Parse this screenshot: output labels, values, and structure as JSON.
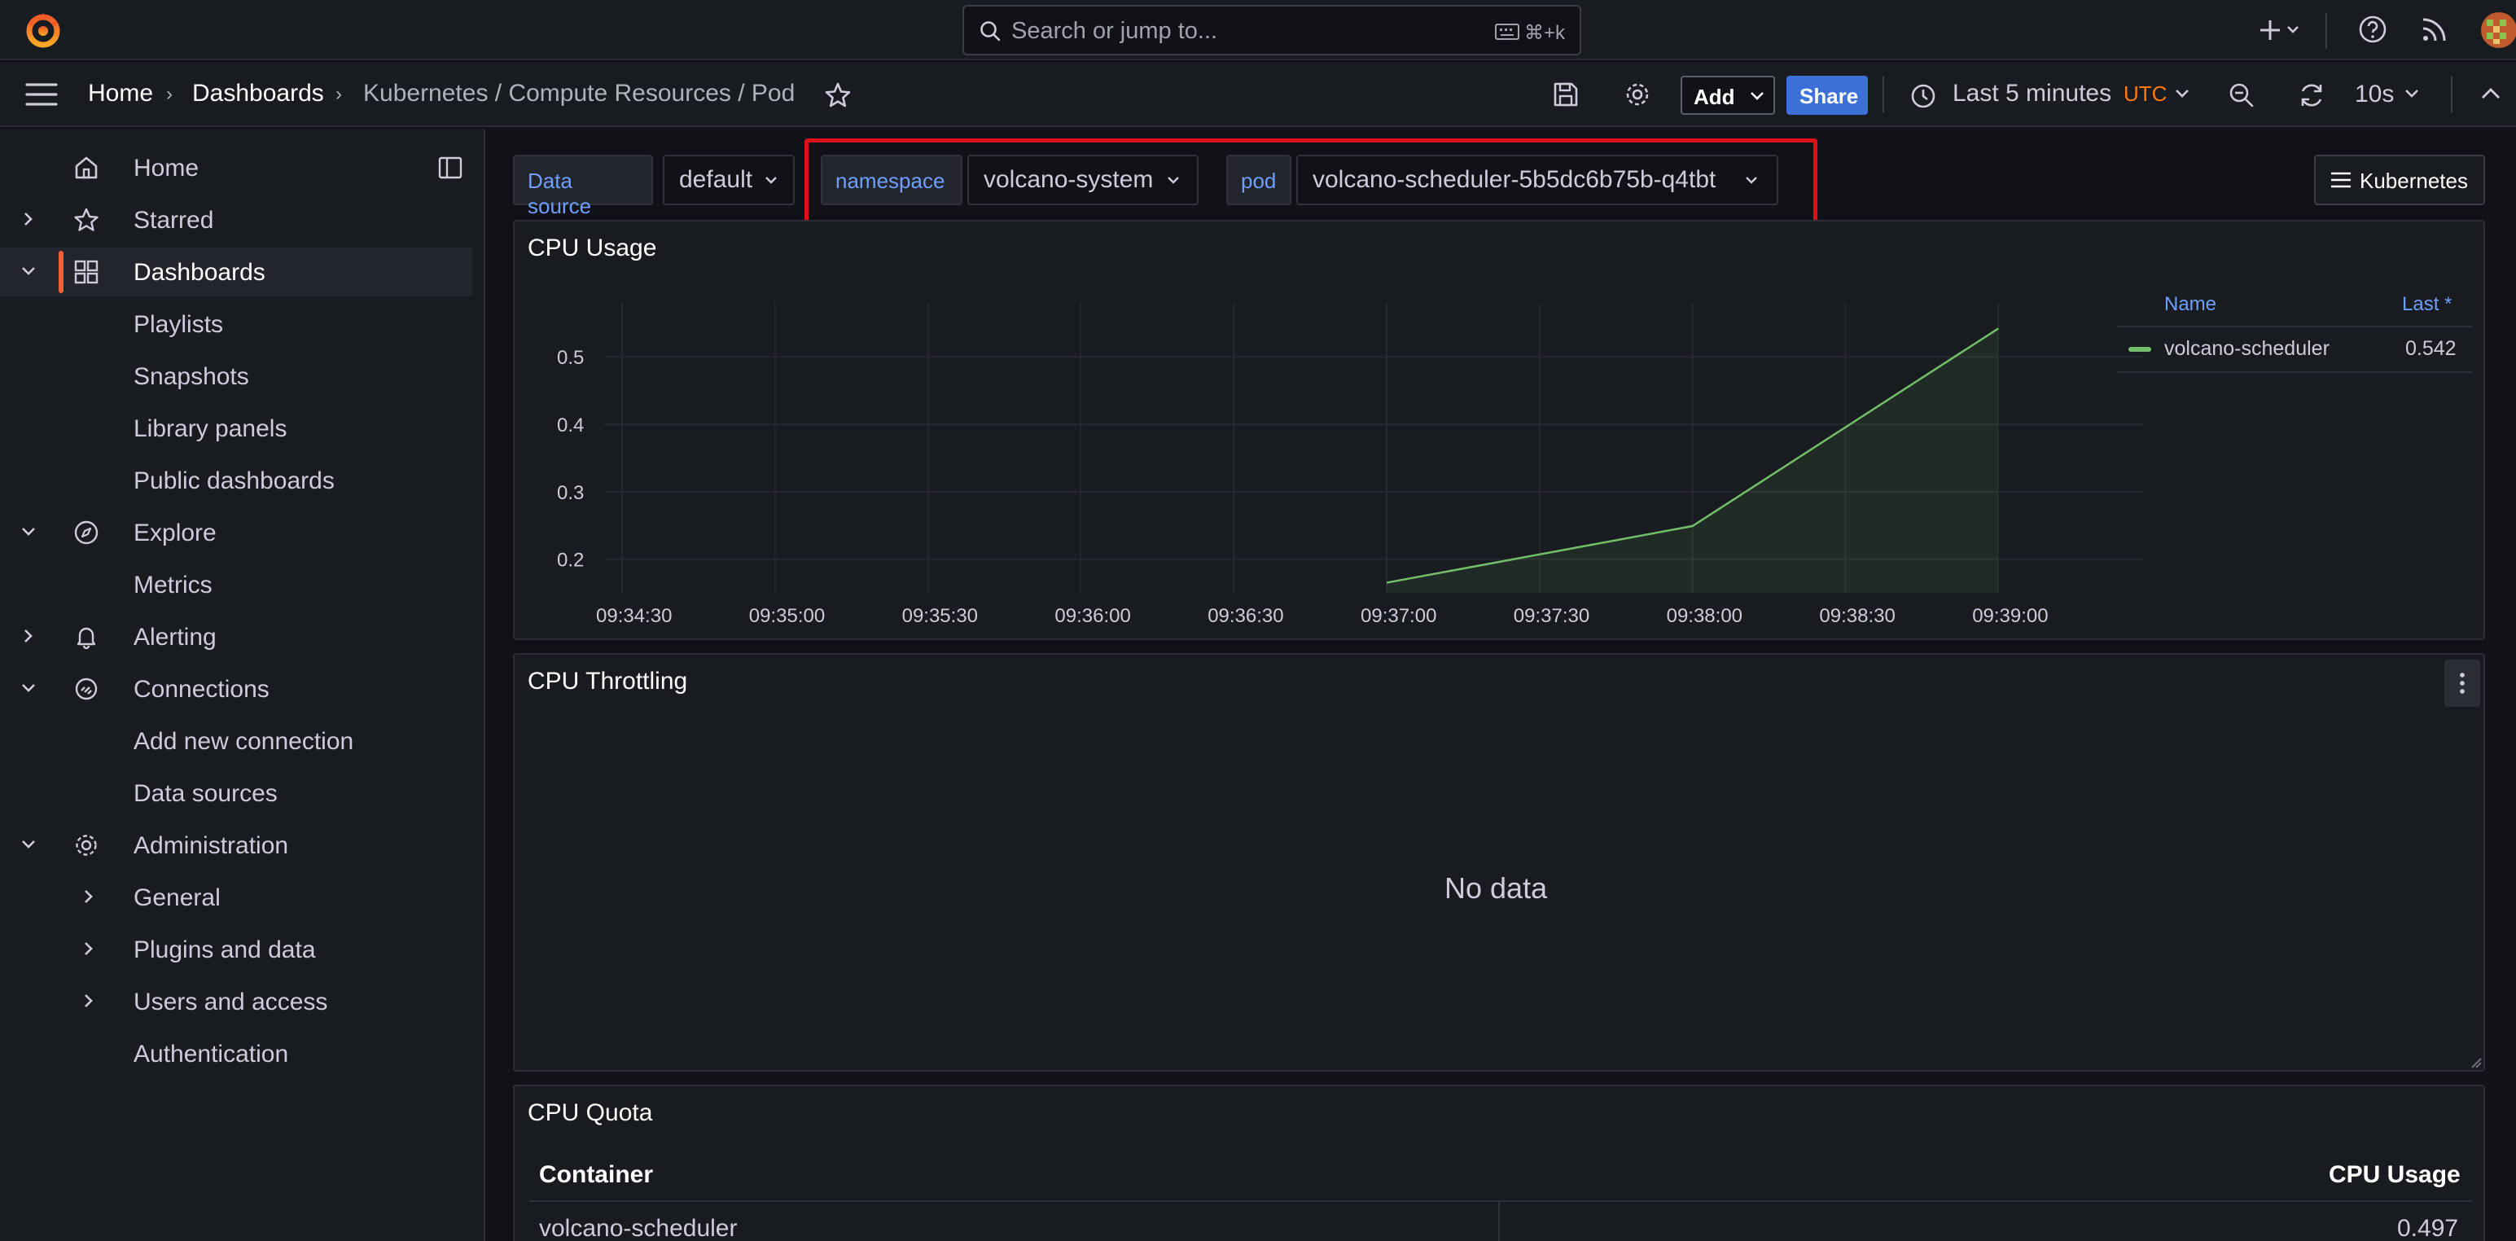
{
  "search": {
    "placeholder": "Search or jump to...",
    "shortcut": "⌘+k"
  },
  "breadcrumb": {
    "home": "Home",
    "dashboards": "Dashboards",
    "current": "Kubernetes / Compute Resources / Pod"
  },
  "toolbar": {
    "add_label": "Add",
    "share_label": "Share",
    "time_range": "Last 5 minutes",
    "timezone": "UTC",
    "refresh": "10s"
  },
  "sidebar": {
    "items": [
      {
        "label": "Home",
        "level": 0,
        "icon": "home-icon"
      },
      {
        "label": "Starred",
        "level": 0,
        "icon": "star-icon",
        "expandable": true
      },
      {
        "label": "Dashboards",
        "level": 0,
        "icon": "apps-icon",
        "expanded": true,
        "active": true
      },
      {
        "label": "Playlists",
        "level": 1
      },
      {
        "label": "Snapshots",
        "level": 1
      },
      {
        "label": "Library panels",
        "level": 1
      },
      {
        "label": "Public dashboards",
        "level": 1
      },
      {
        "label": "Explore",
        "level": 0,
        "icon": "compass-icon",
        "expanded": true
      },
      {
        "label": "Metrics",
        "level": 1
      },
      {
        "label": "Alerting",
        "level": 0,
        "icon": "bell-icon",
        "expandable": true
      },
      {
        "label": "Connections",
        "level": 0,
        "icon": "link-icon",
        "expanded": true
      },
      {
        "label": "Add new connection",
        "level": 1
      },
      {
        "label": "Data sources",
        "level": 1
      },
      {
        "label": "Administration",
        "level": 0,
        "icon": "cog-icon",
        "expanded": true
      },
      {
        "label": "General",
        "level": 1,
        "expandable": true
      },
      {
        "label": "Plugins and data",
        "level": 1,
        "expandable": true
      },
      {
        "label": "Users and access",
        "level": 1,
        "expandable": true
      },
      {
        "label": "Authentication",
        "level": 1
      }
    ]
  },
  "variables": {
    "datasource_label": "Data source",
    "datasource_value": "default",
    "namespace_label": "namespace",
    "namespace_value": "volcano-system",
    "pod_label": "pod",
    "pod_value": "volcano-scheduler-5b5dc6b75b-q4tbt"
  },
  "dashboard_links": {
    "kubernetes": "Kubernetes"
  },
  "panels": {
    "cpu_usage": {
      "title": "CPU Usage",
      "legend_name_header": "Name",
      "legend_last_header": "Last *",
      "legend_series": "volcano-scheduler",
      "legend_last": "0.542"
    },
    "cpu_throttling": {
      "title": "CPU Throttling",
      "no_data": "No data"
    },
    "cpu_quota": {
      "title": "CPU Quota",
      "col_container": "Container",
      "col_cpu_usage": "CPU Usage",
      "row_container": "volcano-scheduler",
      "row_cpu_usage": "0.497"
    }
  },
  "colors": {
    "accent": "#f55f3e",
    "series": "#73bf69",
    "link": "#6e9fff",
    "share": "#3d71d9",
    "highlight": "#e0101a"
  },
  "chart_data": {
    "type": "area",
    "title": "CPU Usage",
    "x": [
      "09:34:30",
      "09:35:00",
      "09:35:30",
      "09:36:00",
      "09:36:30",
      "09:37:00",
      "09:37:30",
      "09:38:00",
      "09:38:30",
      "09:39:00"
    ],
    "yticks": [
      0.2,
      0.3,
      0.4,
      0.5
    ],
    "ylim": [
      0.15,
      0.58
    ],
    "series": [
      {
        "name": "volcano-scheduler",
        "points": [
          [
            "09:37:00",
            0.165
          ],
          [
            "09:38:00",
            0.249
          ],
          [
            "09:39:00",
            0.542
          ]
        ]
      }
    ],
    "grid": true,
    "legend": "right"
  }
}
